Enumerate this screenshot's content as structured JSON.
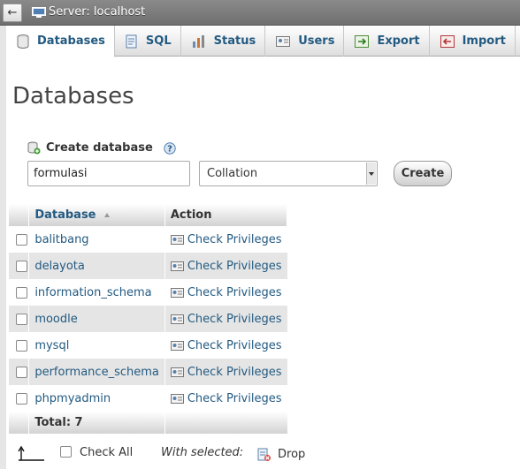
{
  "server_bar": {
    "back_glyph": "←",
    "title": "Server: localhost"
  },
  "tabs": [
    {
      "label": "Databases",
      "icon": "database-icon",
      "active": true
    },
    {
      "label": "SQL",
      "icon": "sql-icon"
    },
    {
      "label": "Status",
      "icon": "status-icon"
    },
    {
      "label": "Users",
      "icon": "users-icon"
    },
    {
      "label": "Export",
      "icon": "export-icon"
    },
    {
      "label": "Import",
      "icon": "import-icon"
    }
  ],
  "page_title": "Databases",
  "create": {
    "label": "Create database",
    "input_value": "formulasi",
    "collation_selected": "Collation",
    "button": "Create"
  },
  "table": {
    "headers": {
      "database": "Database",
      "action": "Action"
    },
    "rows": [
      {
        "name": "balitbang",
        "action": "Check Privileges"
      },
      {
        "name": "delayota",
        "action": "Check Privileges"
      },
      {
        "name": "information_schema",
        "action": "Check Privileges"
      },
      {
        "name": "moodle",
        "action": "Check Privileges"
      },
      {
        "name": "mysql",
        "action": "Check Privileges"
      },
      {
        "name": "performance_schema",
        "action": "Check Privileges"
      },
      {
        "name": "phpmyadmin",
        "action": "Check Privileges"
      }
    ],
    "total": "Total: 7"
  },
  "footer": {
    "check_all": "Check All",
    "with_selected": "With selected:",
    "drop": "Drop"
  },
  "colors": {
    "link": "#235a81",
    "server_bar": "#7a7a7a",
    "row_alt": "#e5e5e5"
  }
}
